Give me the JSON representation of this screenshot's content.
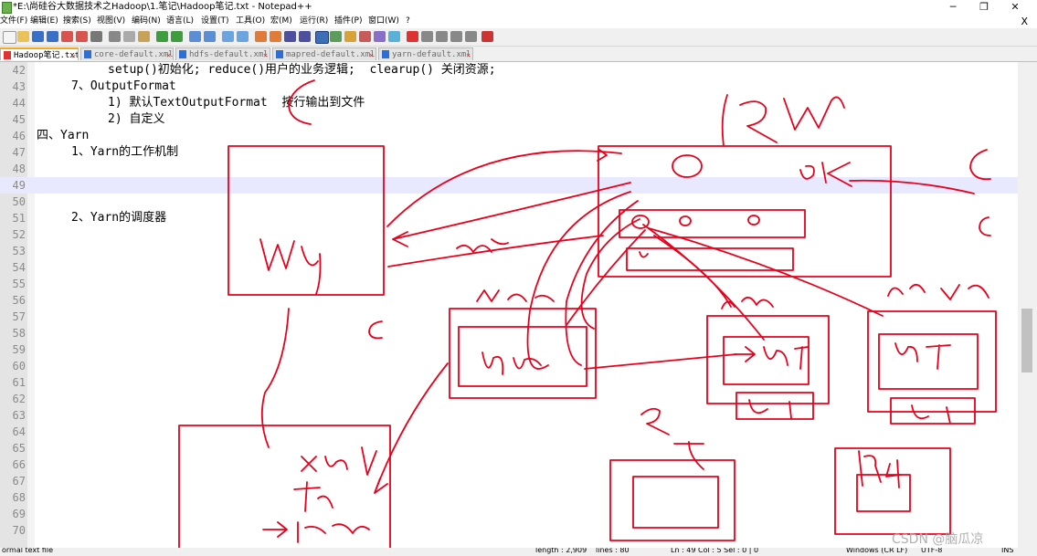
{
  "window": {
    "title": "*E:\\尚硅谷大数据技术之Hadoop\\1.笔记\\Hadoop笔记.txt - Notepad++",
    "minimize": "─",
    "maximize": "❐",
    "close": "✕"
  },
  "menu": {
    "items": [
      "文件(F)",
      "编辑(E)",
      "搜索(S)",
      "视图(V)",
      "编码(N)",
      "语言(L)",
      "设置(T)",
      "工具(O)",
      "宏(M)",
      "运行(R)",
      "插件(P)",
      "窗口(W)",
      "?"
    ],
    "close_doc": "X"
  },
  "tabs": [
    {
      "label": "Hadoop笔记.txt",
      "close": "✕"
    },
    {
      "label": "core-default.xml",
      "close": "✕"
    },
    {
      "label": "hdfs-default.xml",
      "close": "✕"
    },
    {
      "label": "mapred-default.xml",
      "close": "✕"
    },
    {
      "label": "yarn-default.xml",
      "close": "✕"
    }
  ],
  "editor": {
    "current_line": "49",
    "lines": [
      {
        "n": "42",
        "text": "setup()初始化; reduce()用户的业务逻辑;  clearup() 关闭资源;"
      },
      {
        "n": "43",
        "text": "7、OutputFormat"
      },
      {
        "n": "44",
        "text": "1) 默认TextOutputFormat  按行输出到文件"
      },
      {
        "n": "45",
        "text": "2) 自定义"
      },
      {
        "n": "46",
        "text": "四、Yarn"
      },
      {
        "n": "47",
        "text": "1、Yarn的工作机制"
      },
      {
        "n": "48",
        "text": ""
      },
      {
        "n": "49",
        "text": ""
      },
      {
        "n": "50",
        "text": ""
      },
      {
        "n": "51",
        "text": "2、Yarn的调度器"
      },
      {
        "n": "52",
        "text": ""
      },
      {
        "n": "53",
        "text": ""
      },
      {
        "n": "54",
        "text": ""
      },
      {
        "n": "55",
        "text": ""
      },
      {
        "n": "56",
        "text": ""
      },
      {
        "n": "57",
        "text": ""
      },
      {
        "n": "58",
        "text": ""
      },
      {
        "n": "59",
        "text": ""
      },
      {
        "n": "60",
        "text": ""
      },
      {
        "n": "61",
        "text": ""
      },
      {
        "n": "62",
        "text": ""
      },
      {
        "n": "63",
        "text": ""
      },
      {
        "n": "64",
        "text": ""
      },
      {
        "n": "65",
        "text": ""
      },
      {
        "n": "66",
        "text": ""
      },
      {
        "n": "67",
        "text": ""
      },
      {
        "n": "68",
        "text": ""
      },
      {
        "n": "69",
        "text": ""
      },
      {
        "n": "70",
        "text": ""
      }
    ]
  },
  "status": {
    "type": "ormal text file",
    "length": "length : 2,909",
    "lines": "lines : 80",
    "pos": "Ln : 49   Col : 5   Sel : 0 | 0",
    "eol": "Windows (CR LF)",
    "encoding": "UTF-8",
    "mode": "INS"
  },
  "annotation_color": "#e8001c",
  "watermark": "CSDN @脑瓜凉"
}
